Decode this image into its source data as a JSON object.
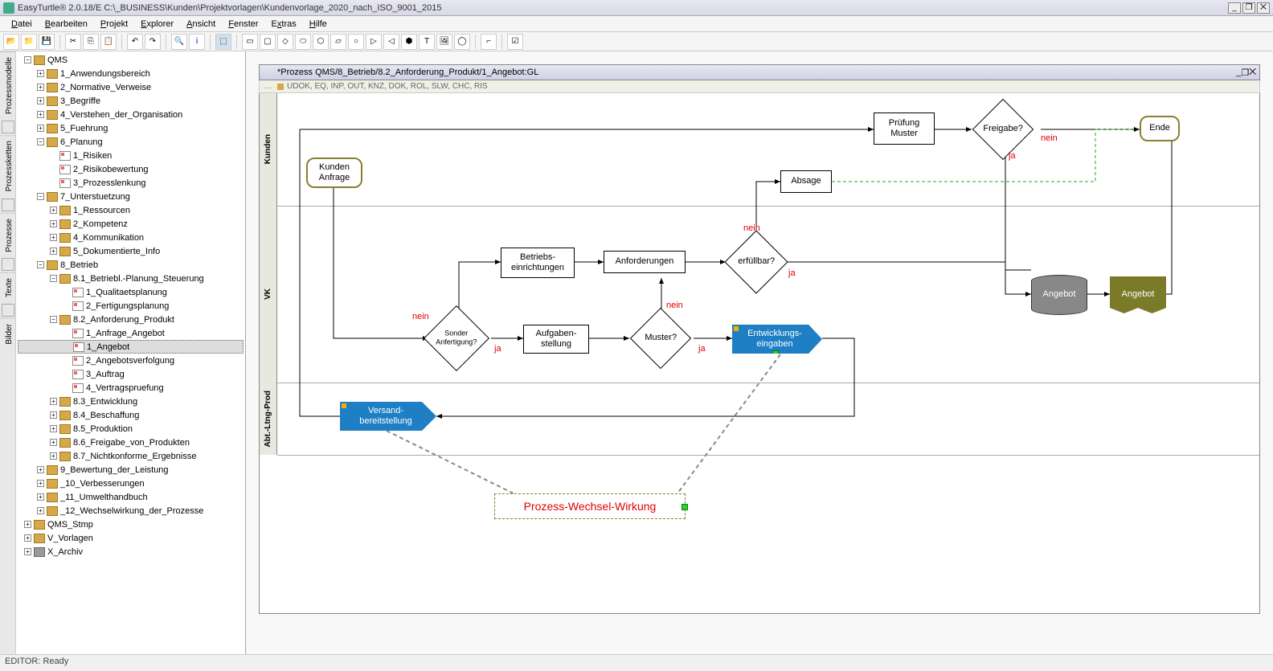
{
  "app_title": "EasyTurtle® 2.0.18/E C:\\_BUSINESS\\Kunden\\Projektvorlagen\\Kundenvorlage_2020_nach_ISO_9001_2015",
  "menu": {
    "m1": "Datei",
    "m2": "Bearbeiten",
    "m3": "Projekt",
    "m4": "Explorer",
    "m5": "Ansicht",
    "m6": "Fenster",
    "m7": "Extras",
    "m8": "Hilfe"
  },
  "sidetabs": {
    "t1": "Prozessmodelle",
    "t2": "Prozessketten",
    "t3": "Prozesse",
    "t4": "Texte",
    "t5": "Bilder"
  },
  "tree": {
    "root": "QMS",
    "n1": "1_Anwendungsbereich",
    "n2": "2_Normative_Verweise",
    "n3": "3_Begriffe",
    "n4": "4_Verstehen_der_Organisation",
    "n5": "5_Fuehrung",
    "n6": "6_Planung",
    "n6_1": "1_Risiken",
    "n6_2": "2_Risikobewertung",
    "n6_3": "3_Prozesslenkung",
    "n7": "7_Unterstuetzung",
    "n7_1": "1_Ressourcen",
    "n7_2": "2_Kompetenz",
    "n7_3": "4_Kommunikation",
    "n7_4": "5_Dokumentierte_Info",
    "n8": "8_Betrieb",
    "n8_1": "8.1_Betriebl.-Planung_Steuerung",
    "n8_1_1": "1_Qualitaetsplanung",
    "n8_1_2": "2_Fertigungsplanung",
    "n8_2": "8.2_Anforderung_Produkt",
    "n8_2_1": "1_Anfrage_Angebot",
    "n8_2_2": "1_Angebot",
    "n8_2_3": "2_Angebotsverfolgung",
    "n8_2_4": "3_Auftrag",
    "n8_2_5": "4_Vertragspruefung",
    "n8_3": "8.3_Entwicklung",
    "n8_4": "8.4_Beschaffung",
    "n8_5": "8.5_Produktion",
    "n8_6": "8.6_Freigabe_von_Produkten",
    "n8_7": "8.7_Nichtkonforme_Ergebnisse",
    "n9": "9_Bewertung_der_Leistung",
    "n10": "_10_Verbesserungen",
    "n11": "_11_Umwelthandbuch",
    "n12": "_12_Wechselwirkung_der_Prozesse",
    "qms_stmp": "QMS_Stmp",
    "vvorl": "V_Vorlagen",
    "xarch": "X_Archiv"
  },
  "canvas": {
    "title": "*Prozess QMS/8_Betrieb/8.2_Anforderung_Produkt/1_Angebot:GL",
    "subtitle": "UDOK, EQ, INP, OUT, KNZ, DOK, ROL, SLW, CHC, RIS",
    "swim1": "Kunden",
    "swim2": "VK",
    "swim3": "Abt.-Ltng-Prod"
  },
  "shapes": {
    "kunden_anfrage": "Kunden\nAnfrage",
    "pruefung_muster": "Prüfung\nMuster",
    "freigabe": "Freigabe?",
    "ende": "Ende",
    "absage": "Absage",
    "betriebs": "Betriebs-\neinrichtungen",
    "anforderungen": "Anforderungen",
    "erfuellbar": "erfüllbar?",
    "sonder": "Sonder\nAnfertigung?",
    "aufgaben": "Aufgaben-\nstellung",
    "muster": "Muster?",
    "entwicklungs": "Entwicklungs-\neingaben",
    "angebot_cyl": "Angebot",
    "angebot_doc": "Angebot",
    "versand": "Versand-\nbereitstellung",
    "prozess_wechsel": "Prozess-Wechsel-Wirkung"
  },
  "labels": {
    "ja": "ja",
    "nein": "nein"
  },
  "status": "EDITOR: Ready"
}
